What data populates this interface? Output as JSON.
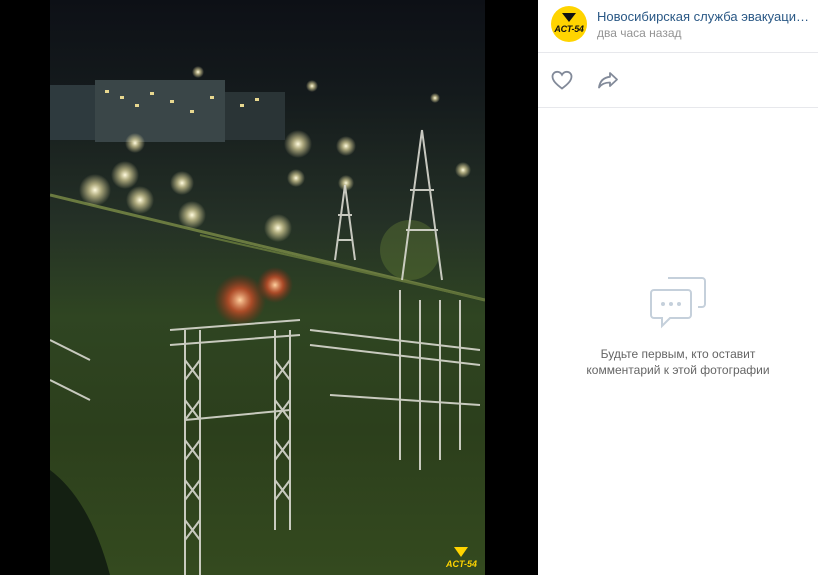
{
  "post": {
    "author": "Новосибирская служба эвакуации...",
    "time": "два часа назад",
    "avatar_text": "ACT-54"
  },
  "photo": {
    "watermark": "ACT-54"
  },
  "comments": {
    "empty_line1": "Будьте первым, кто оставит",
    "empty_line2": "комментарий к этой фотографии"
  },
  "colors": {
    "link": "#2a5885",
    "muted": "#939393",
    "brand": "#ffd400"
  },
  "icons": [
    "heart-icon",
    "share-arrow-icon",
    "chat-bubble-icon"
  ]
}
